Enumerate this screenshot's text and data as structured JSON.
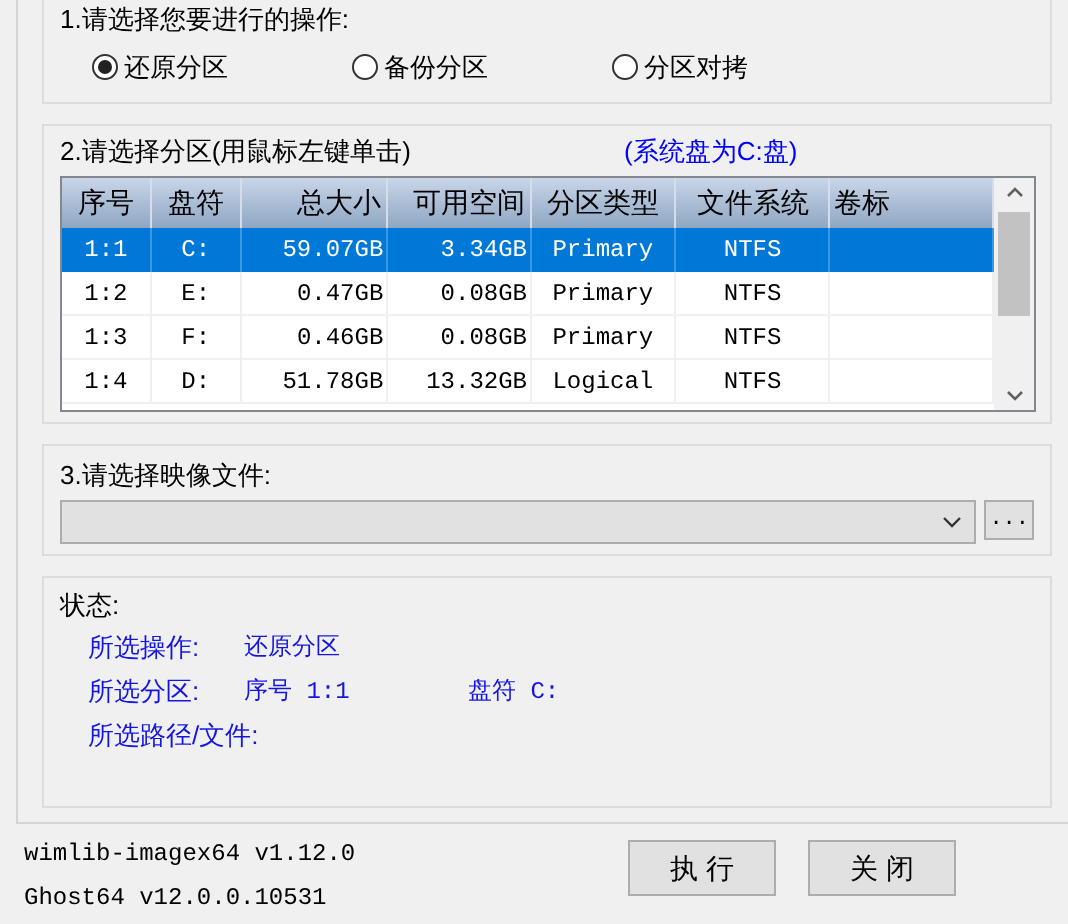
{
  "operation": {
    "title": "1.请选择您要进行的操作:",
    "options": [
      {
        "label": "还原分区",
        "selected": true
      },
      {
        "label": "备份分区",
        "selected": false
      },
      {
        "label": "分区对拷",
        "selected": false
      }
    ]
  },
  "partition": {
    "title": "2.请选择分区(用鼠标左键单击)",
    "note": "(系统盘为C:盘)",
    "table": {
      "columns": [
        "序号",
        "盘符",
        "总大小",
        "可用空间",
        "分区类型",
        "文件系统",
        "卷标"
      ],
      "rows": [
        {
          "selected": true,
          "cells": [
            "1:1",
            "C:",
            "59.07GB",
            "3.34GB",
            "Primary",
            "NTFS"
          ]
        },
        {
          "selected": false,
          "cells": [
            "1:2",
            "E:",
            "0.47GB",
            "0.08GB",
            "Primary",
            "NTFS"
          ]
        },
        {
          "selected": false,
          "cells": [
            "1:3",
            "F:",
            "0.46GB",
            "0.08GB",
            "Primary",
            "NTFS"
          ]
        },
        {
          "selected": false,
          "cells": [
            "1:4",
            "D:",
            "51.78GB",
            "13.32GB",
            "Logical",
            "NTFS"
          ]
        }
      ]
    }
  },
  "image_file": {
    "title": "3.请选择映像文件:",
    "browse_button": "..."
  },
  "status": {
    "title": "状态:",
    "lines": [
      {
        "parts": [
          "所选操作:",
          "还原分区"
        ]
      },
      {
        "parts": [
          "所选分区:",
          "序号 1:1",
          "盘符 C:"
        ]
      },
      {
        "parts": [
          "所选路径/文件:"
        ]
      }
    ]
  },
  "versions": [
    "wimlib-imagex64 v1.12.0",
    "Ghost64 v12.0.0.10531"
  ],
  "buttons": [
    "执 行",
    "关 闭"
  ]
}
